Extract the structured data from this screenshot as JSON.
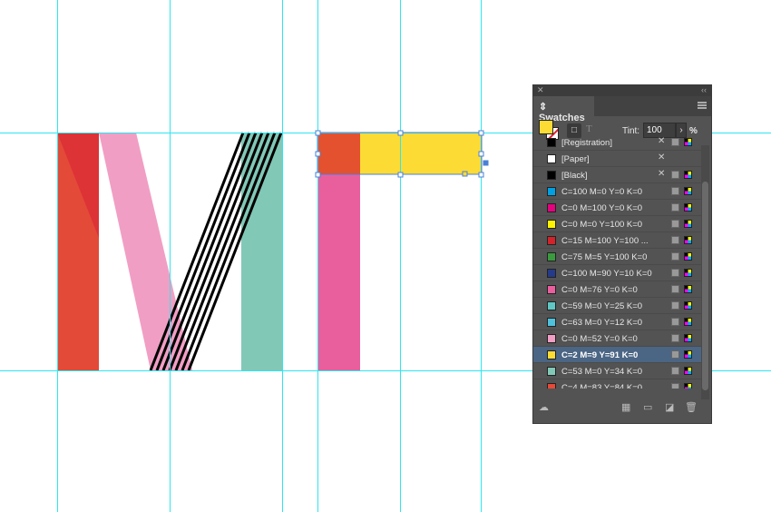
{
  "panel": {
    "title": "Swatches",
    "tint_label": "Tint:",
    "tint_value": "100",
    "pct": "%",
    "text_btn": "T"
  },
  "swatches": [
    {
      "name": "[Registration]",
      "color": "#000000"
    },
    {
      "name": "[Paper]",
      "color": "#ffffff"
    },
    {
      "name": "[Black]",
      "color": "#000000"
    },
    {
      "name": "C=100 M=0 Y=0 K=0",
      "color": "#00a0e3"
    },
    {
      "name": "C=0 M=100 Y=0 K=0",
      "color": "#e5007e"
    },
    {
      "name": "C=0 M=0 Y=100 K=0",
      "color": "#fff200"
    },
    {
      "name": "C=15 M=100 Y=100 ...",
      "color": "#d1232a"
    },
    {
      "name": "C=75 M=5 Y=100 K=0",
      "color": "#3a9a3e"
    },
    {
      "name": "C=100 M=90 Y=10 K=0",
      "color": "#253a8a"
    },
    {
      "name": "C=0 M=76 Y=0 K=0",
      "color": "#e95f9e"
    },
    {
      "name": "C=59 M=0 Y=25 K=0",
      "color": "#5fc6c4"
    },
    {
      "name": "C=63 M=0 Y=12 K=0",
      "color": "#4fc1dc"
    },
    {
      "name": "C=0 M=52 Y=0 K=0",
      "color": "#f19ec4"
    },
    {
      "name": "C=2 M=9 Y=91 K=0",
      "color": "#fddb35",
      "selected": true
    },
    {
      "name": "C=53 M=0 Y=34 K=0",
      "color": "#82c8b7"
    },
    {
      "name": "C=4 M=83 Y=84 K=0",
      "color": "#e34a38"
    }
  ]
}
